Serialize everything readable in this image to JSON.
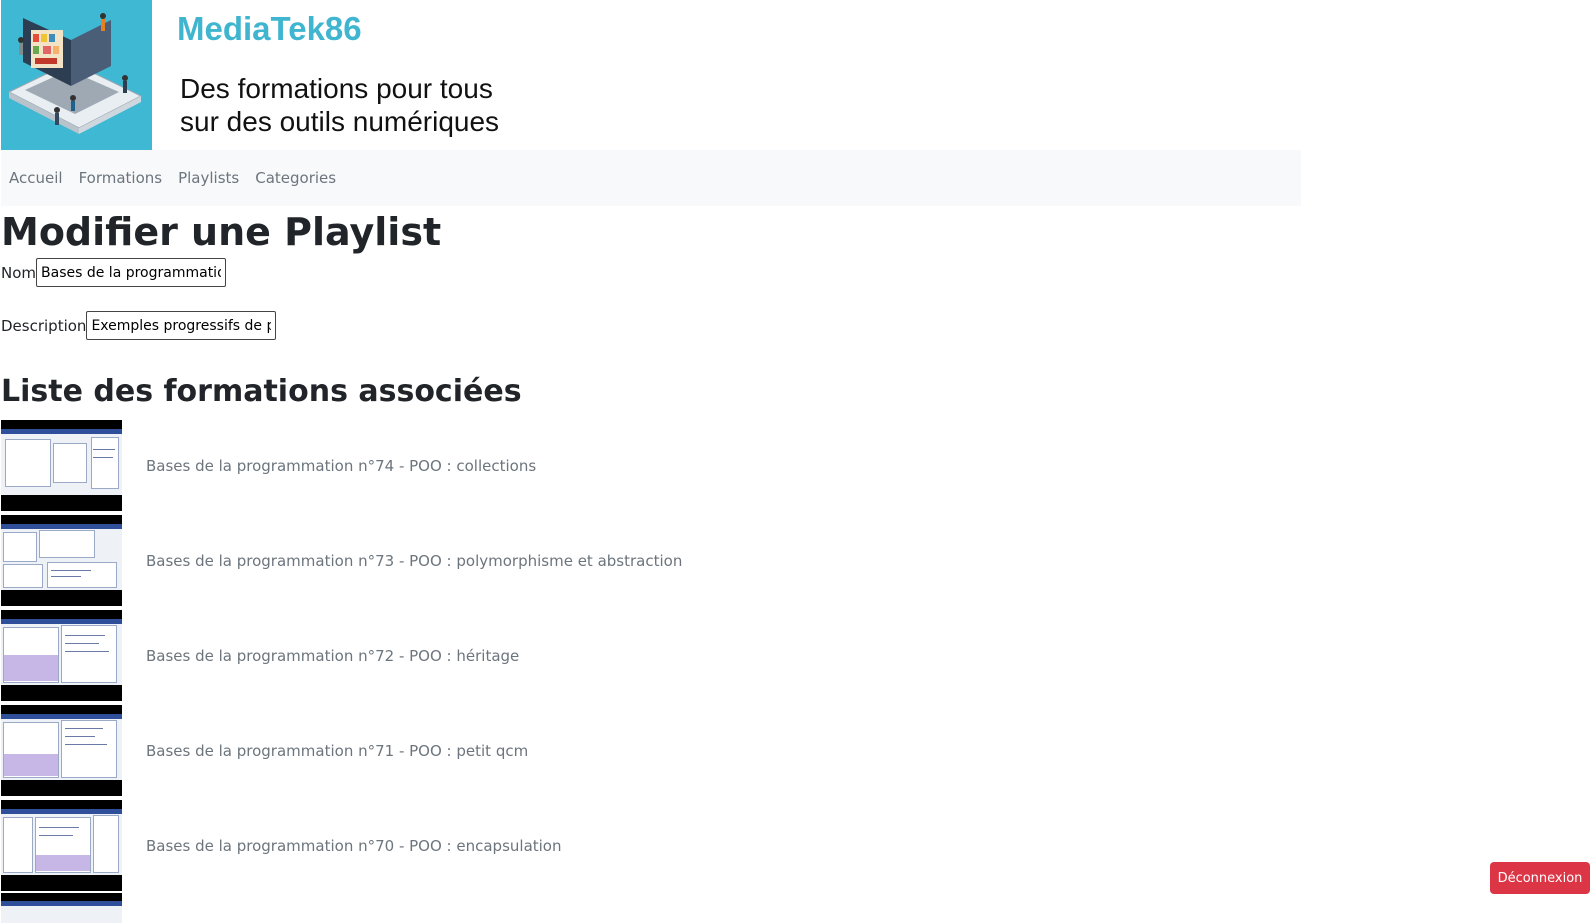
{
  "header": {
    "site_name": "MediaTek86",
    "tagline_line1": "Des formations pour tous",
    "tagline_line2": "sur des outils numériques",
    "logo_icon": "laptop-library-illustration"
  },
  "nav": {
    "items": [
      {
        "label": "Accueil"
      },
      {
        "label": "Formations"
      },
      {
        "label": "Playlists"
      },
      {
        "label": "Categories"
      }
    ]
  },
  "main": {
    "title": "Modifier une Playlist",
    "name_label": "Nom",
    "name_value": "Bases de la programmation",
    "description_label": "Description",
    "description_value": "Exemples progressifs de p",
    "formations_title": "Liste des formations associées",
    "formations": [
      {
        "title": "Bases de la programmation n°74 - POO : collections"
      },
      {
        "title": "Bases de la programmation n°73 - POO : polymorphisme et abstraction"
      },
      {
        "title": "Bases de la programmation n°72 - POO : héritage"
      },
      {
        "title": "Bases de la programmation n°71 - POO : petit qcm"
      },
      {
        "title": "Bases de la programmation n°70 - POO : encapsulation"
      }
    ]
  },
  "logout": {
    "label": "Déconnexion"
  },
  "colors": {
    "brand": "#3fb5cf",
    "logout": "#dc3545",
    "navbar_bg": "#f8f9fa",
    "link": "#6c757d"
  }
}
